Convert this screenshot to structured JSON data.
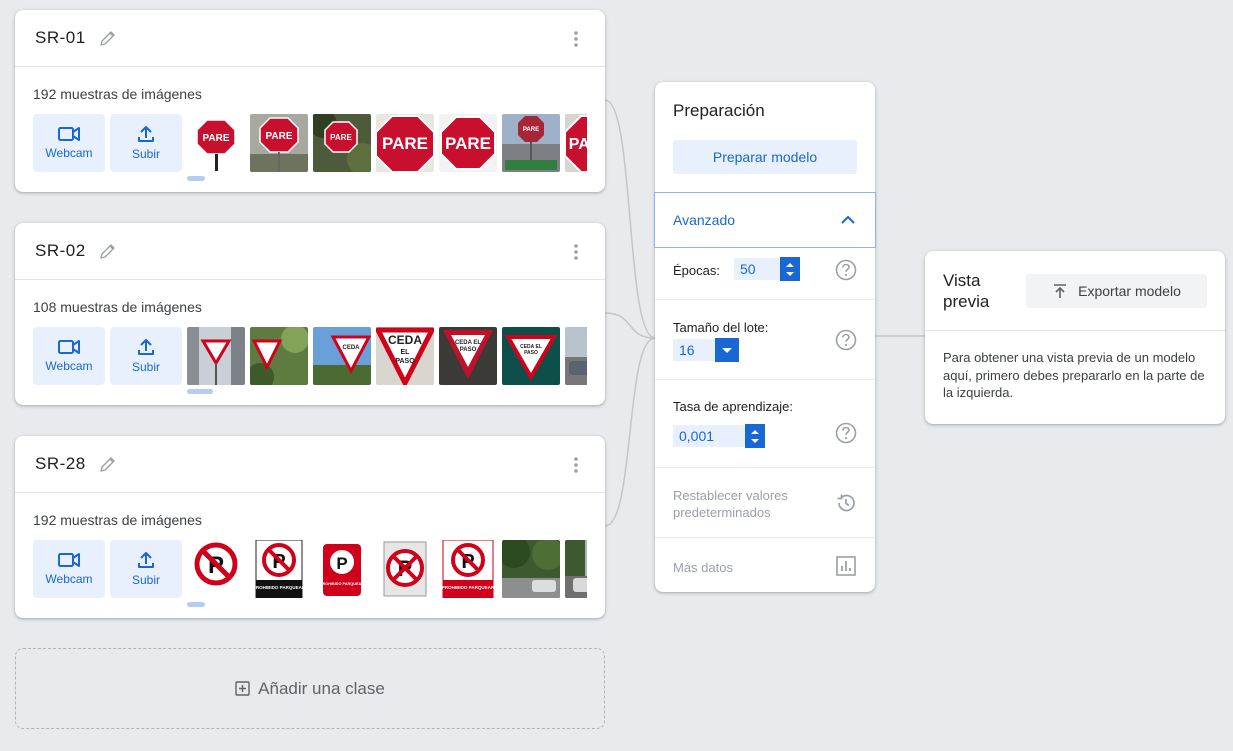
{
  "classes": [
    {
      "name": "SR-01",
      "sample_count": "192 muestras de imágenes",
      "webcam_label": "Webcam",
      "upload_label": "Subir",
      "thumb_text": [
        "PARE",
        "PARE",
        "PARE",
        "PARE",
        "PARE",
        "PARE",
        "PAR"
      ]
    },
    {
      "name": "SR-02",
      "sample_count": "108 muestras de imágenes",
      "webcam_label": "Webcam",
      "upload_label": "Subir",
      "thumb_text": [
        "CEDA",
        "EL",
        "PASO",
        "CEDA EL",
        "PASO",
        "CEDA EL",
        "PASO"
      ]
    },
    {
      "name": "SR-28",
      "sample_count": "192 muestras de imágenes",
      "webcam_label": "Webcam",
      "upload_label": "Subir",
      "thumb_text": [
        "PROHIBIDO PARQUEAR",
        "PROHIBIDO PARQUEAR",
        "PROHIBIDO PARQUEAR"
      ]
    }
  ],
  "add_class_label": "Añadir una clase",
  "training": {
    "title": "Preparación",
    "train_button": "Preparar modelo",
    "advanced_label": "Avanzado",
    "epochs_label": "Épocas:",
    "epochs_value": "50",
    "batch_label": "Tamaño del lote:",
    "batch_value": "16",
    "lr_label": "Tasa de aprendizaje:",
    "lr_value": "0,001",
    "reset_label": "Restablecer valores predeterminados",
    "more_data_label": "Más datos"
  },
  "preview": {
    "title": "Vista previa",
    "export_button": "Exportar modelo",
    "message": "Para obtener una vista previa de un modelo aquí, primero debes prepararlo en la parte de la izquierda."
  },
  "colors": {
    "accent": "#1967d2",
    "accent_light": "#e8f0fe",
    "background": "#e8eaed",
    "stop_red": "#c8102e",
    "yield_red": "#d0021b"
  }
}
